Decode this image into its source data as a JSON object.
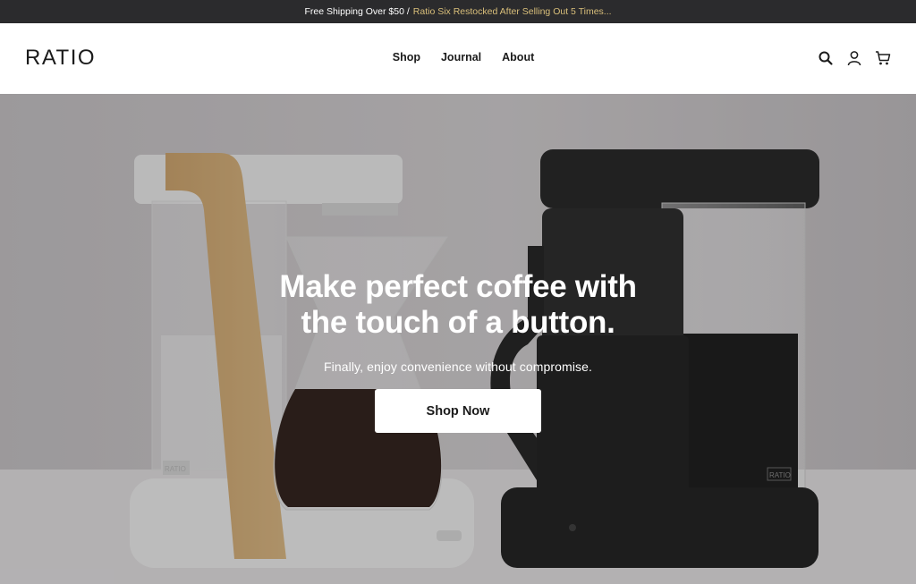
{
  "announcement": {
    "prefix": "Free Shipping Over $50 /",
    "promo": "Ratio Six Restocked After Selling Out 5 Times..."
  },
  "header": {
    "logo": "RATIO",
    "nav": [
      "Shop",
      "Journal",
      "About"
    ],
    "icons": [
      "search-icon",
      "account-icon",
      "cart-icon"
    ]
  },
  "hero": {
    "headline_line1": "Make perfect coffee with",
    "headline_line2": "the touch of a button.",
    "subheadline": "Finally, enjoy convenience without compromise.",
    "cta_label": "Shop Now",
    "image_label_left": "RATIO",
    "image_label_right": "RATIO"
  },
  "colors": {
    "announcement_bg": "#2b2b2d",
    "promo_text": "#d9bf7a",
    "hero_bg": "#b7b4b6"
  }
}
